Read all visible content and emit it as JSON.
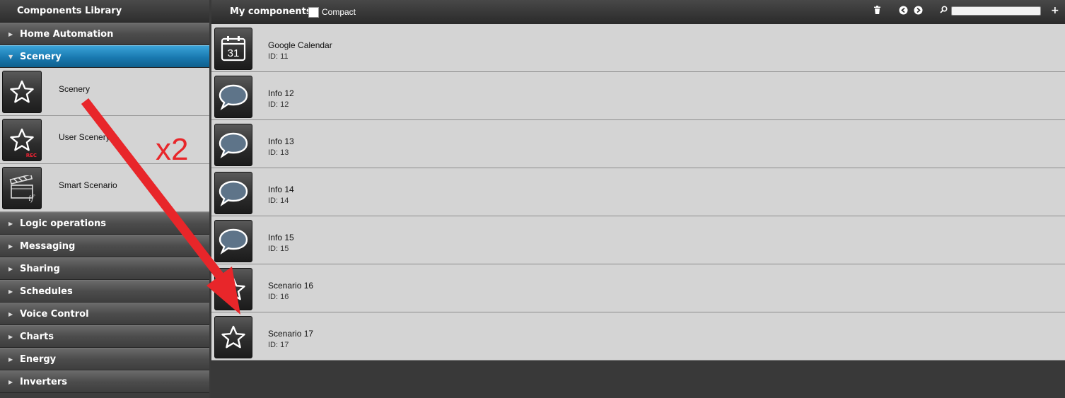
{
  "sidebar": {
    "title": "Components Library",
    "categories_top": [
      {
        "label": "Home Automation"
      },
      {
        "label": "Scenery"
      }
    ],
    "scenery_items": [
      {
        "label": "Scenery",
        "icon": "star-icon"
      },
      {
        "label": "User Scenery",
        "icon": "star-rec-icon",
        "badge": "REC"
      },
      {
        "label": "Smart Scenario",
        "icon": "clapperboard-if-icon",
        "badge": "if"
      }
    ],
    "categories_bottom": [
      {
        "label": "Logic operations"
      },
      {
        "label": "Messaging"
      },
      {
        "label": "Sharing"
      },
      {
        "label": "Schedules"
      },
      {
        "label": "Voice Control"
      },
      {
        "label": "Charts"
      },
      {
        "label": "Energy"
      },
      {
        "label": "Inverters"
      }
    ]
  },
  "toolbar": {
    "title": "My components",
    "compact_label": "Compact",
    "compact_checked": false
  },
  "components": [
    {
      "name": "Google Calendar",
      "id": "ID: 11",
      "icon": "calendar-icon",
      "calendar_day": "31"
    },
    {
      "name": "Info 12",
      "id": "ID: 12",
      "icon": "speech-bubble-icon"
    },
    {
      "name": "Info 13",
      "id": "ID: 13",
      "icon": "speech-bubble-icon"
    },
    {
      "name": "Info 14",
      "id": "ID: 14",
      "icon": "speech-bubble-icon"
    },
    {
      "name": "Info 15",
      "id": "ID: 15",
      "icon": "speech-bubble-icon"
    },
    {
      "name": "Scenario 16",
      "id": "ID: 16",
      "icon": "star-icon"
    },
    {
      "name": "Scenario 17",
      "id": "ID: 17",
      "icon": "star-icon"
    }
  ],
  "annotation": {
    "text": "x2",
    "color": "#e8262a"
  },
  "colors": {
    "active_category": "#1979b0",
    "row_background": "#d4d4d4"
  }
}
